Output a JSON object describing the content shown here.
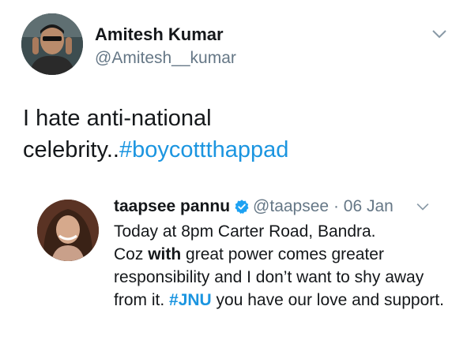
{
  "tweet": {
    "author_name": "Amitesh Kumar",
    "author_handle": "@Amitesh__kumar",
    "text_plain_1": "I hate anti-national",
    "text_plain_2": "celebrity..",
    "hashtag": "#boycottthappad",
    "menu_icon": "chevron-down-icon"
  },
  "quoted_tweet": {
    "author_name": "taapsee pannu",
    "verified_icon": "verified-badge-icon",
    "author_handle": "@taapsee",
    "separator": "·",
    "date": "06 Jan",
    "line_1": "Today at 8pm Carter Road, Bandra.",
    "coz": "Coz ",
    "with_bold": "with",
    "after_with": " great power comes greater responsibility and I don’t want to shy away from it. ",
    "hashtag": "#JNU",
    "after_hashtag": " you have our love and support.",
    "menu_icon": "chevron-down-icon"
  },
  "colors": {
    "link": "#1b95e0",
    "verified": "#1da1f2",
    "secondary_text": "#657786",
    "primary_text": "#14171a"
  }
}
